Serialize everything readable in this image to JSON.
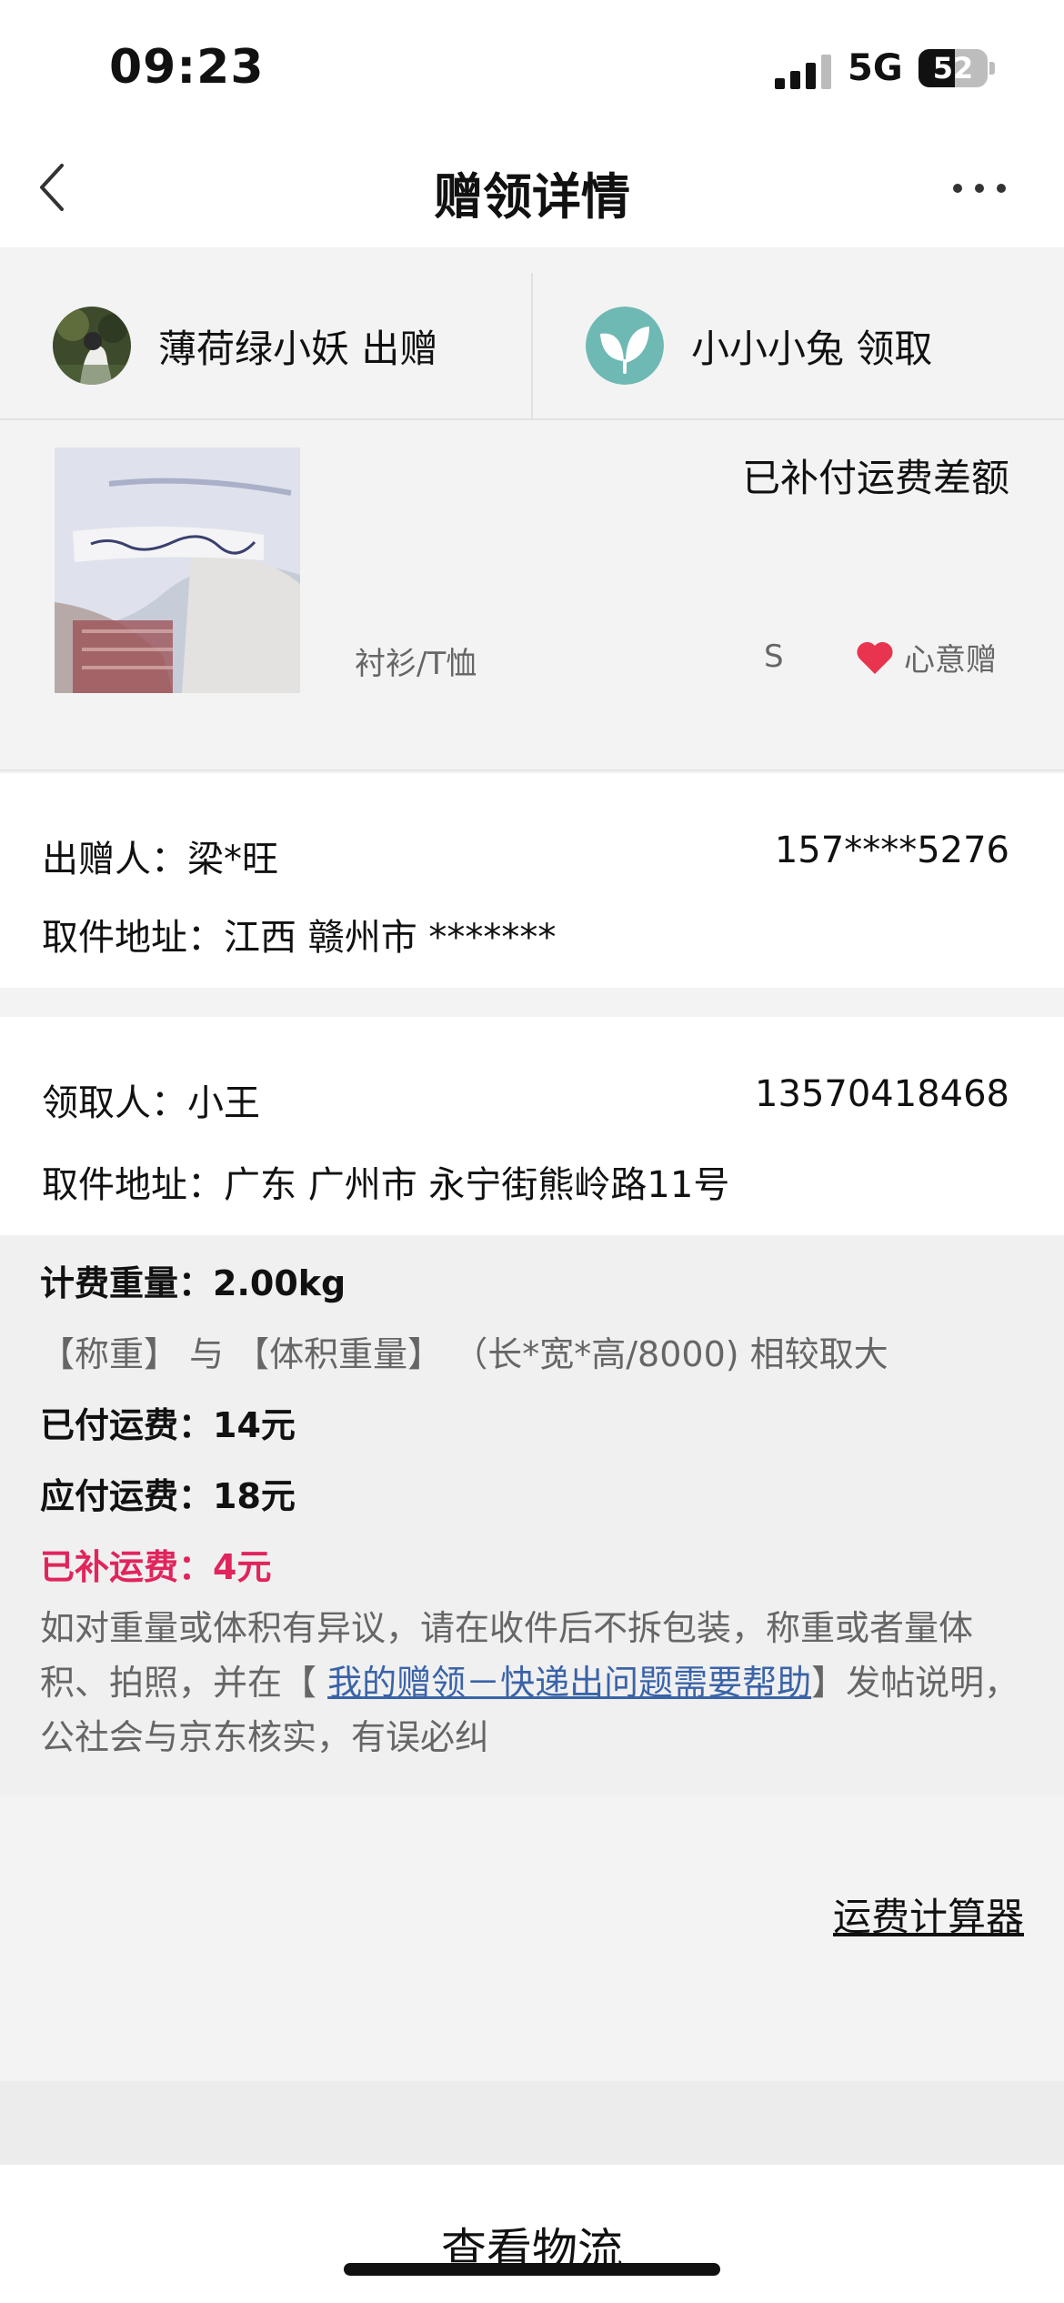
{
  "status_bar": {
    "time": "09:23",
    "network": "5G",
    "battery": "52",
    "battery_level": 0.52
  },
  "header": {
    "title": "赠领详情"
  },
  "parties": {
    "giver": {
      "name": "薄荷绿小妖",
      "role": "出赠"
    },
    "receiver": {
      "name": "小小小兔",
      "role": "领取"
    }
  },
  "item": {
    "status": "已补付运费差额",
    "category": "衬衫/T恤",
    "size": "S",
    "tag": "心意赠"
  },
  "giver_info": {
    "name_label": "出赠人：",
    "name": "梁*旺",
    "phone": "157****5276",
    "address_label": "取件地址：",
    "address": "江西 赣州市 *******"
  },
  "receiver_info": {
    "name_label": "领取人：",
    "name": "小王",
    "phone": "13570418468",
    "address_label": "取件地址：",
    "address": "广东 广州市 永宁街熊岭路11号"
  },
  "fee": {
    "weight": "计费重量：2.00kg",
    "weight_note": "【称重】 与 【体积重量】 （长*宽*高/8000) 相较取大",
    "paid": "已付运费：14元",
    "payable": "应付运费：18元",
    "supplement": "已补运费：4元",
    "help_before": "如对重量或体积有异议，请在收件后不拆包装，称重或者量体积、拍照，并在【 ",
    "help_link": "我的赠领－快递出问题需要帮助",
    "help_after": "】发帖说明，公社会与京东核实，有误必纠"
  },
  "calculator_link": "运费计算器",
  "bottom": {
    "logistics_button": "查看物流"
  },
  "colors": {
    "accent_red": "#e0255c",
    "link_blue": "#3a63a8",
    "heart": "#e8344e"
  }
}
